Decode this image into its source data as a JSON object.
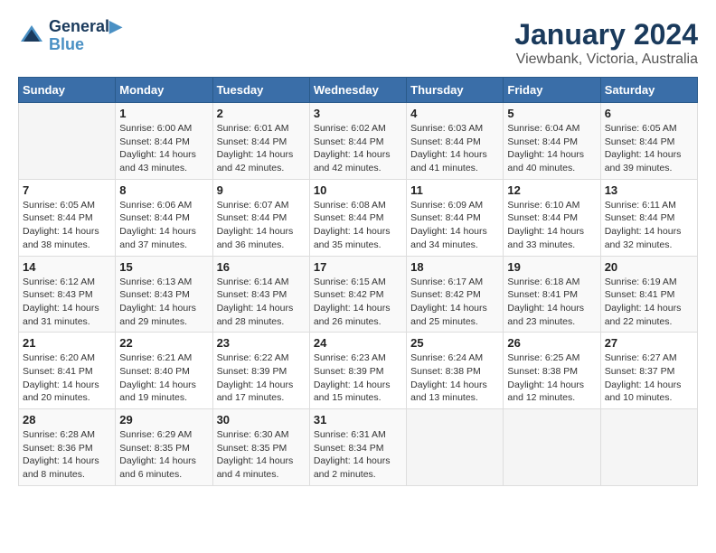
{
  "logo": {
    "line1": "General",
    "line2": "Blue"
  },
  "title": "January 2024",
  "subtitle": "Viewbank, Victoria, Australia",
  "days_header": [
    "Sunday",
    "Monday",
    "Tuesday",
    "Wednesday",
    "Thursday",
    "Friday",
    "Saturday"
  ],
  "weeks": [
    [
      {
        "day": "",
        "info": ""
      },
      {
        "day": "1",
        "info": "Sunrise: 6:00 AM\nSunset: 8:44 PM\nDaylight: 14 hours\nand 43 minutes."
      },
      {
        "day": "2",
        "info": "Sunrise: 6:01 AM\nSunset: 8:44 PM\nDaylight: 14 hours\nand 42 minutes."
      },
      {
        "day": "3",
        "info": "Sunrise: 6:02 AM\nSunset: 8:44 PM\nDaylight: 14 hours\nand 42 minutes."
      },
      {
        "day": "4",
        "info": "Sunrise: 6:03 AM\nSunset: 8:44 PM\nDaylight: 14 hours\nand 41 minutes."
      },
      {
        "day": "5",
        "info": "Sunrise: 6:04 AM\nSunset: 8:44 PM\nDaylight: 14 hours\nand 40 minutes."
      },
      {
        "day": "6",
        "info": "Sunrise: 6:05 AM\nSunset: 8:44 PM\nDaylight: 14 hours\nand 39 minutes."
      }
    ],
    [
      {
        "day": "7",
        "info": "Sunrise: 6:05 AM\nSunset: 8:44 PM\nDaylight: 14 hours\nand 38 minutes."
      },
      {
        "day": "8",
        "info": "Sunrise: 6:06 AM\nSunset: 8:44 PM\nDaylight: 14 hours\nand 37 minutes."
      },
      {
        "day": "9",
        "info": "Sunrise: 6:07 AM\nSunset: 8:44 PM\nDaylight: 14 hours\nand 36 minutes."
      },
      {
        "day": "10",
        "info": "Sunrise: 6:08 AM\nSunset: 8:44 PM\nDaylight: 14 hours\nand 35 minutes."
      },
      {
        "day": "11",
        "info": "Sunrise: 6:09 AM\nSunset: 8:44 PM\nDaylight: 14 hours\nand 34 minutes."
      },
      {
        "day": "12",
        "info": "Sunrise: 6:10 AM\nSunset: 8:44 PM\nDaylight: 14 hours\nand 33 minutes."
      },
      {
        "day": "13",
        "info": "Sunrise: 6:11 AM\nSunset: 8:44 PM\nDaylight: 14 hours\nand 32 minutes."
      }
    ],
    [
      {
        "day": "14",
        "info": "Sunrise: 6:12 AM\nSunset: 8:43 PM\nDaylight: 14 hours\nand 31 minutes."
      },
      {
        "day": "15",
        "info": "Sunrise: 6:13 AM\nSunset: 8:43 PM\nDaylight: 14 hours\nand 29 minutes."
      },
      {
        "day": "16",
        "info": "Sunrise: 6:14 AM\nSunset: 8:43 PM\nDaylight: 14 hours\nand 28 minutes."
      },
      {
        "day": "17",
        "info": "Sunrise: 6:15 AM\nSunset: 8:42 PM\nDaylight: 14 hours\nand 26 minutes."
      },
      {
        "day": "18",
        "info": "Sunrise: 6:17 AM\nSunset: 8:42 PM\nDaylight: 14 hours\nand 25 minutes."
      },
      {
        "day": "19",
        "info": "Sunrise: 6:18 AM\nSunset: 8:41 PM\nDaylight: 14 hours\nand 23 minutes."
      },
      {
        "day": "20",
        "info": "Sunrise: 6:19 AM\nSunset: 8:41 PM\nDaylight: 14 hours\nand 22 minutes."
      }
    ],
    [
      {
        "day": "21",
        "info": "Sunrise: 6:20 AM\nSunset: 8:41 PM\nDaylight: 14 hours\nand 20 minutes."
      },
      {
        "day": "22",
        "info": "Sunrise: 6:21 AM\nSunset: 8:40 PM\nDaylight: 14 hours\nand 19 minutes."
      },
      {
        "day": "23",
        "info": "Sunrise: 6:22 AM\nSunset: 8:39 PM\nDaylight: 14 hours\nand 17 minutes."
      },
      {
        "day": "24",
        "info": "Sunrise: 6:23 AM\nSunset: 8:39 PM\nDaylight: 14 hours\nand 15 minutes."
      },
      {
        "day": "25",
        "info": "Sunrise: 6:24 AM\nSunset: 8:38 PM\nDaylight: 14 hours\nand 13 minutes."
      },
      {
        "day": "26",
        "info": "Sunrise: 6:25 AM\nSunset: 8:38 PM\nDaylight: 14 hours\nand 12 minutes."
      },
      {
        "day": "27",
        "info": "Sunrise: 6:27 AM\nSunset: 8:37 PM\nDaylight: 14 hours\nand 10 minutes."
      }
    ],
    [
      {
        "day": "28",
        "info": "Sunrise: 6:28 AM\nSunset: 8:36 PM\nDaylight: 14 hours\nand 8 minutes."
      },
      {
        "day": "29",
        "info": "Sunrise: 6:29 AM\nSunset: 8:35 PM\nDaylight: 14 hours\nand 6 minutes."
      },
      {
        "day": "30",
        "info": "Sunrise: 6:30 AM\nSunset: 8:35 PM\nDaylight: 14 hours\nand 4 minutes."
      },
      {
        "day": "31",
        "info": "Sunrise: 6:31 AM\nSunset: 8:34 PM\nDaylight: 14 hours\nand 2 minutes."
      },
      {
        "day": "",
        "info": ""
      },
      {
        "day": "",
        "info": ""
      },
      {
        "day": "",
        "info": ""
      }
    ]
  ]
}
